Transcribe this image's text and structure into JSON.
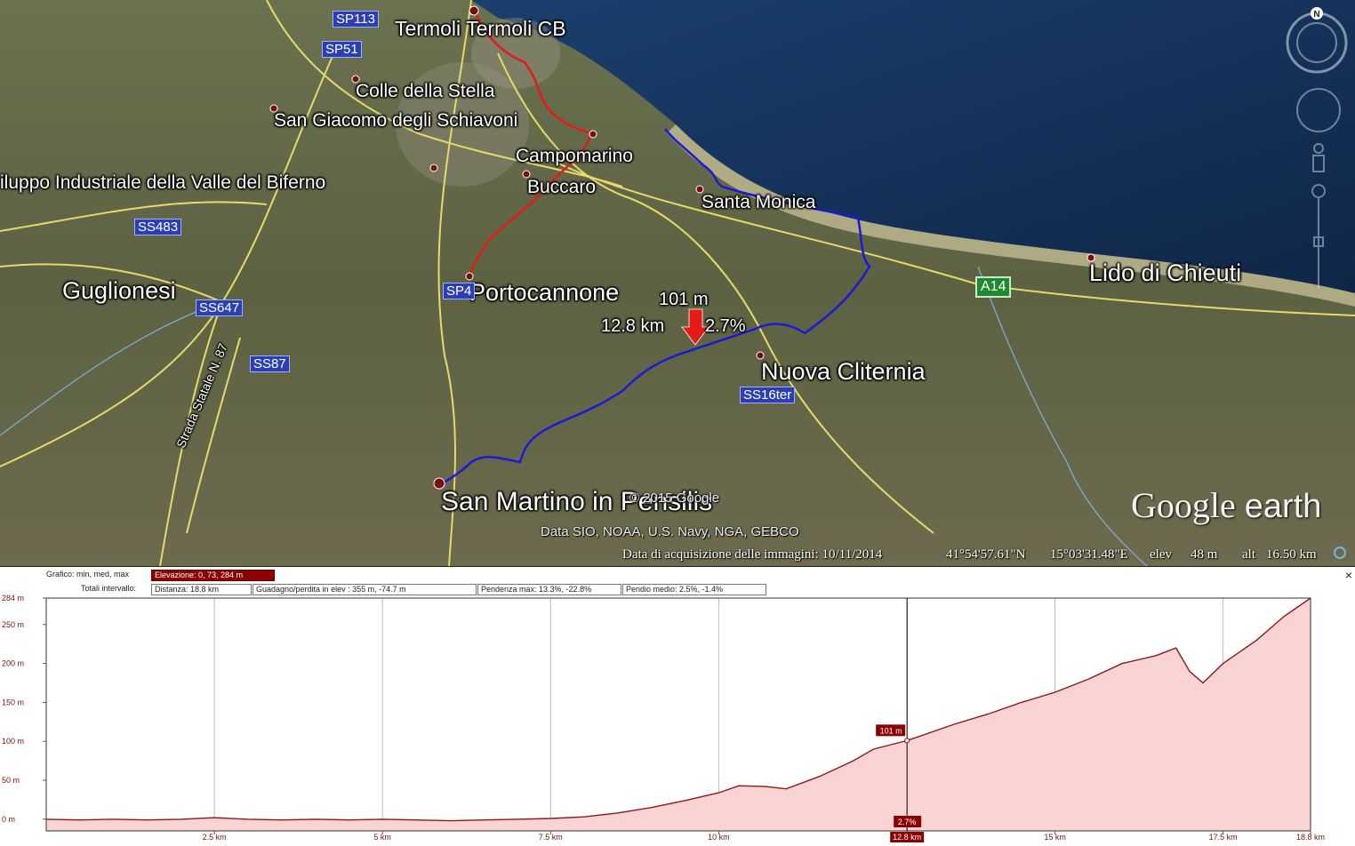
{
  "map": {
    "places": [
      {
        "name": "Termoli Termoli CB",
        "size": "md"
      },
      {
        "name": "Colle della Stella",
        "size": "sm"
      },
      {
        "name": "San Giacomo degli Schiavoni",
        "size": "sm"
      },
      {
        "name": "Campomarino",
        "size": "sm"
      },
      {
        "name": "iluppo Industriale della Valle del Biferno",
        "size": "sm"
      },
      {
        "name": "Buccaro",
        "size": "sm"
      },
      {
        "name": "Santa Monica",
        "size": "sm"
      },
      {
        "name": "Guglionesi",
        "size": "lg"
      },
      {
        "name": "Portocannone",
        "size": "lg"
      },
      {
        "name": "Lido di Chieuti",
        "size": "lg"
      },
      {
        "name": "Nuova Cliternia",
        "size": "lg"
      },
      {
        "name": "San Martino in Pensilis",
        "size": "lg"
      }
    ],
    "roads": [
      "SP113",
      "SP51",
      "SS483",
      "SS647",
      "SS87",
      "SP4",
      "SS16ter"
    ],
    "motorway": "A14",
    "road_label": "Strada Statale N. 87",
    "marker": {
      "elevation": "101 m",
      "distance": "12.8 km",
      "slope": "2.7%"
    },
    "copyright": "© 2015 Google",
    "data_credits": "Data SIO, NOAA, U.S. Navy, NGA, GEBCO",
    "brand": {
      "word1": "Google",
      "word2": "earth"
    },
    "status": {
      "acquisition": "Data di acquisizione delle immagini: 10/11/2014",
      "lat": "41°54'57.61\"N",
      "lon": "15°03'31.48\"E",
      "elev_label": "elev",
      "elev_value": "48 m",
      "alt_label": "alt",
      "alt_value": "16.50 km"
    },
    "compass_north": "N",
    "colors": {
      "sea": "#17355e",
      "land": "#5d6645",
      "route_red": "#e41b17",
      "route_blue": "#1a1ad6",
      "road_yellow": "#e7d96a"
    }
  },
  "profile": {
    "stats": {
      "graph_label": "Grafico: min, med, max",
      "elevation": "Elevazione: 0, 73, 284 m",
      "totals_label": "Totali intervallo:",
      "distance": "Distanza: 18.8 km",
      "gain_loss": "Guadagno/perdita in elev : 355 m, -74.7 m",
      "max_slope": "Pendenza max: 13.3%, -22.8%",
      "avg_slope": "Pendio medio: 2.5%, -1.4%"
    },
    "close_label": "×",
    "cursor": {
      "elevation": "101 m",
      "slope": "2.7%",
      "distance": "12.8 km"
    }
  },
  "chart_data": {
    "type": "area",
    "title": "",
    "xlabel": "",
    "ylabel": "",
    "xlim": [
      0,
      18.8
    ],
    "ylim": [
      -15,
      284
    ],
    "y_ticks": [
      {
        "v": 284,
        "l": "284 m"
      },
      {
        "v": 250,
        "l": "250 m"
      },
      {
        "v": 200,
        "l": "200 m"
      },
      {
        "v": 150,
        "l": "150 m"
      },
      {
        "v": 100,
        "l": "100 m"
      },
      {
        "v": 50,
        "l": "50 m"
      },
      {
        "v": 0,
        "l": "0 m"
      }
    ],
    "x_ticks": [
      {
        "v": 2.5,
        "l": "2.5 km"
      },
      {
        "v": 5,
        "l": "5 km"
      },
      {
        "v": 7.5,
        "l": "7.5 km"
      },
      {
        "v": 10,
        "l": "10 km"
      },
      {
        "v": 12.8,
        "l": "12.8 km"
      },
      {
        "v": 15,
        "l": "15 km"
      },
      {
        "v": 17.5,
        "l": "17.5 km"
      },
      {
        "v": 18.8,
        "l": "18.8 km"
      }
    ],
    "x": [
      0,
      0.5,
      1,
      1.5,
      2,
      2.5,
      3,
      3.5,
      4,
      4.5,
      5,
      5.5,
      6,
      6.5,
      7,
      7.5,
      8,
      8.5,
      9,
      9.5,
      10,
      10.3,
      10.7,
      11,
      11.5,
      12,
      12.3,
      12.8,
      13.5,
      14,
      14.5,
      15,
      15.5,
      16,
      16.5,
      16.8,
      17,
      17.2,
      17.5,
      18,
      18.4,
      18.8
    ],
    "y": [
      0,
      -1,
      0,
      -1,
      0,
      2,
      0,
      -1,
      0,
      -1,
      0,
      -1,
      -2,
      -1,
      0,
      1,
      3,
      8,
      15,
      24,
      34,
      43,
      42,
      39,
      55,
      75,
      90,
      101,
      122,
      135,
      150,
      163,
      180,
      200,
      210,
      220,
      190,
      175,
      200,
      230,
      260,
      284
    ],
    "series": [
      {
        "values_ref": "y",
        "color": "#8b1a1a"
      }
    ],
    "grid": true,
    "cursor_x": 12.8
  }
}
